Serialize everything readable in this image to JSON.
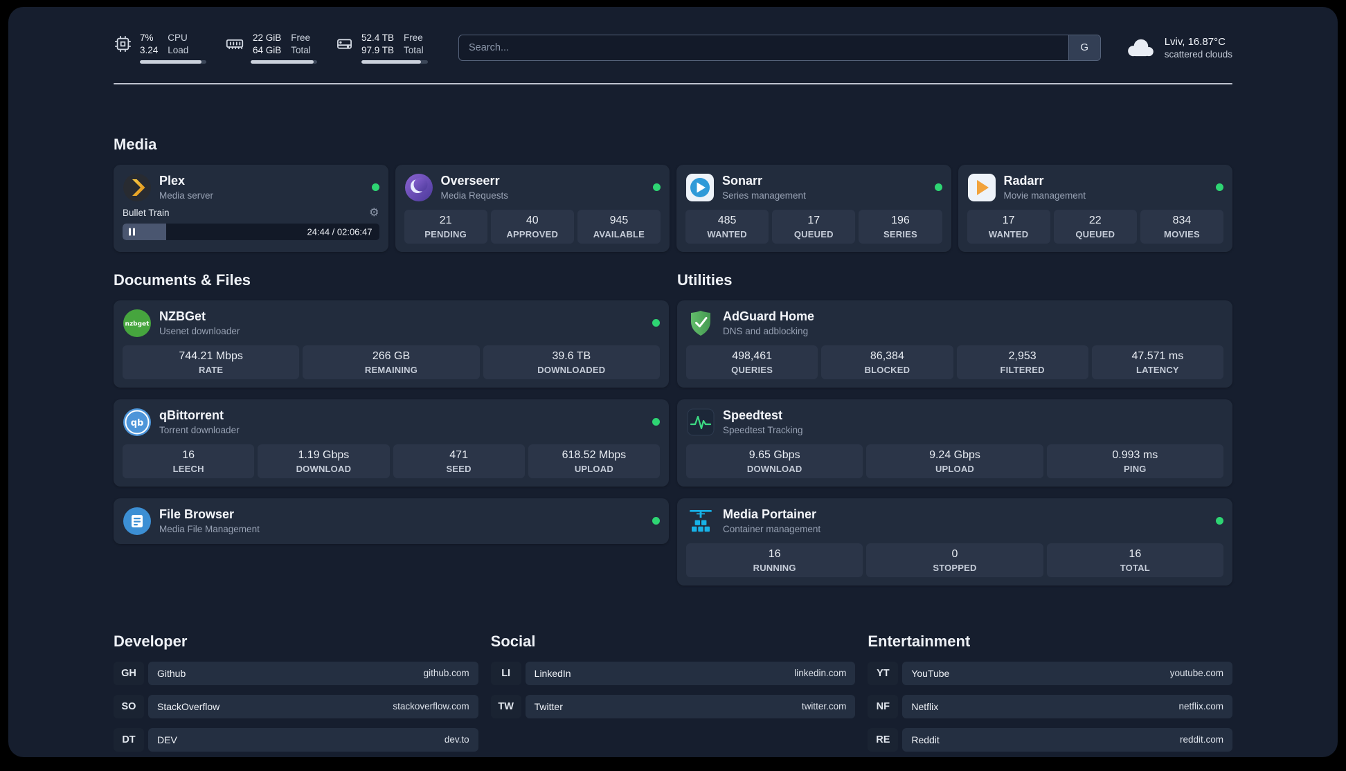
{
  "header": {
    "system": [
      {
        "id": "cpu",
        "value_top": "7%",
        "value_bottom": "3.24",
        "label_top": "CPU",
        "label_bottom": "Load",
        "progress": "93%"
      },
      {
        "id": "ram",
        "value_top": "22 GiB",
        "value_bottom": "64 GiB",
        "label_top": "Free",
        "label_bottom": "Total",
        "progress": "95%"
      },
      {
        "id": "disk",
        "value_top": "52.4 TB",
        "value_bottom": "97.9 TB",
        "label_top": "Free",
        "label_bottom": "Total",
        "progress": "90%"
      }
    ],
    "search": {
      "placeholder": "Search...",
      "button": "G"
    },
    "weather": {
      "location": "Lviv, 16.87°C",
      "condition": "scattered clouds"
    }
  },
  "media": {
    "heading": "Media",
    "plex": {
      "name": "Plex",
      "subtitle": "Media server",
      "now_playing": "Bullet Train",
      "time": "24:44 / 02:06:47",
      "progress": "17%"
    },
    "overseerr": {
      "name": "Overseerr",
      "subtitle": "Media Requests",
      "stats": [
        {
          "value": "21",
          "label": "PENDING"
        },
        {
          "value": "40",
          "label": "APPROVED"
        },
        {
          "value": "945",
          "label": "AVAILABLE"
        }
      ]
    },
    "sonarr": {
      "name": "Sonarr",
      "subtitle": "Series management",
      "stats": [
        {
          "value": "485",
          "label": "WANTED"
        },
        {
          "value": "17",
          "label": "QUEUED"
        },
        {
          "value": "196",
          "label": "SERIES"
        }
      ]
    },
    "radarr": {
      "name": "Radarr",
      "subtitle": "Movie management",
      "stats": [
        {
          "value": "17",
          "label": "WANTED"
        },
        {
          "value": "22",
          "label": "QUEUED"
        },
        {
          "value": "834",
          "label": "MOVIES"
        }
      ]
    }
  },
  "documents": {
    "heading": "Documents & Files",
    "nzbget": {
      "name": "NZBGet",
      "subtitle": "Usenet downloader",
      "stats": [
        {
          "value": "744.21 Mbps",
          "label": "RATE"
        },
        {
          "value": "266 GB",
          "label": "REMAINING"
        },
        {
          "value": "39.6 TB",
          "label": "DOWNLOADED"
        }
      ]
    },
    "qbittorrent": {
      "name": "qBittorrent",
      "subtitle": "Torrent downloader",
      "stats": [
        {
          "value": "16",
          "label": "LEECH"
        },
        {
          "value": "1.19 Gbps",
          "label": "DOWNLOAD"
        },
        {
          "value": "471",
          "label": "SEED"
        },
        {
          "value": "618.52 Mbps",
          "label": "UPLOAD"
        }
      ]
    },
    "filebrowser": {
      "name": "File Browser",
      "subtitle": "Media File Management"
    }
  },
  "utilities": {
    "heading": "Utilities",
    "adguard": {
      "name": "AdGuard Home",
      "subtitle": "DNS and adblocking",
      "stats": [
        {
          "value": "498,461",
          "label": "QUERIES"
        },
        {
          "value": "86,384",
          "label": "BLOCKED"
        },
        {
          "value": "2,953",
          "label": "FILTERED"
        },
        {
          "value": "47.571 ms",
          "label": "LATENCY"
        }
      ]
    },
    "speedtest": {
      "name": "Speedtest",
      "subtitle": "Speedtest Tracking",
      "stats": [
        {
          "value": "9.65 Gbps",
          "label": "DOWNLOAD"
        },
        {
          "value": "9.24 Gbps",
          "label": "UPLOAD"
        },
        {
          "value": "0.993 ms",
          "label": "PING"
        }
      ]
    },
    "portainer": {
      "name": "Media Portainer",
      "subtitle": "Container management",
      "stats": [
        {
          "value": "16",
          "label": "RUNNING"
        },
        {
          "value": "0",
          "label": "STOPPED"
        },
        {
          "value": "16",
          "label": "TOTAL"
        }
      ]
    }
  },
  "bookmarks": [
    {
      "heading": "Developer",
      "items": [
        {
          "abbr": "GH",
          "name": "Github",
          "url": "github.com"
        },
        {
          "abbr": "SO",
          "name": "StackOverflow",
          "url": "stackoverflow.com"
        },
        {
          "abbr": "DT",
          "name": "DEV",
          "url": "dev.to"
        }
      ]
    },
    {
      "heading": "Social",
      "items": [
        {
          "abbr": "LI",
          "name": "LinkedIn",
          "url": "linkedin.com"
        },
        {
          "abbr": "TW",
          "name": "Twitter",
          "url": "twitter.com"
        }
      ]
    },
    {
      "heading": "Entertainment",
      "items": [
        {
          "abbr": "YT",
          "name": "YouTube",
          "url": "youtube.com"
        },
        {
          "abbr": "NF",
          "name": "Netflix",
          "url": "netflix.com"
        },
        {
          "abbr": "RE",
          "name": "Reddit",
          "url": "reddit.com"
        }
      ]
    }
  ]
}
